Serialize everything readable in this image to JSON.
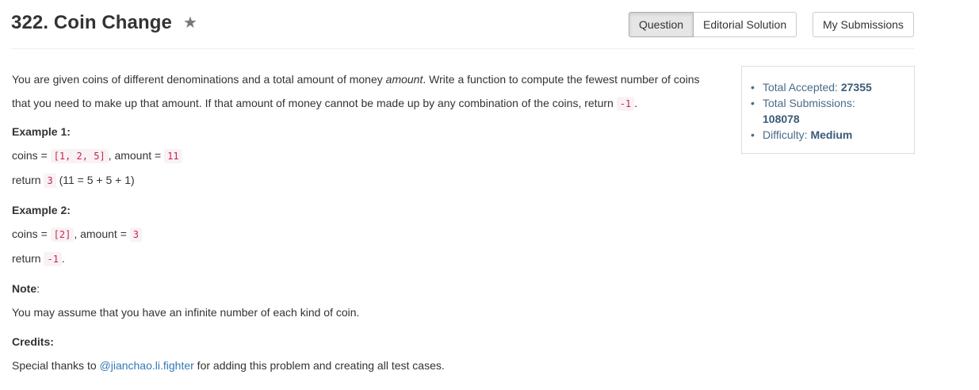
{
  "header": {
    "title": "322. Coin Change",
    "star_icon": "star-icon",
    "tabs": [
      {
        "label": "Question",
        "active": true
      },
      {
        "label": "Editorial Solution",
        "active": false
      }
    ],
    "my_submissions_label": "My Submissions"
  },
  "problem": {
    "intro_pre": "You are given coins of different denominations and a total amount of money ",
    "intro_em": "amount",
    "intro_post": ". Write a function to compute the fewest number of coins",
    "intro_line2": "that you need to make up that amount. If that amount of money cannot be made up by any combination of the coins, return ",
    "intro_code": "-1",
    "intro_end": ".",
    "example1": {
      "heading": "Example 1:",
      "coins_label": "coins = ",
      "coins_code": "[1, 2, 5]",
      "amount_label": ", amount = ",
      "amount_code": "11",
      "return_label": "return ",
      "return_code": "3",
      "return_note": " (11 = 5 + 5 + 1)"
    },
    "example2": {
      "heading": "Example 2:",
      "coins_label": "coins = ",
      "coins_code": "[2]",
      "amount_label": ", amount = ",
      "amount_code": "3",
      "return_label": "return ",
      "return_code": "-1",
      "return_note": "."
    },
    "note": {
      "heading": "Note",
      "colon": ":",
      "text": "You may assume that you have an infinite number of each kind of coin."
    },
    "credits": {
      "heading": "Credits:",
      "pre": "Special thanks to ",
      "link": "@jianchao.li.fighter",
      "post": " for adding this problem and creating all test cases."
    }
  },
  "stats": {
    "accepted_label": "Total Accepted: ",
    "accepted_value": "27355",
    "submissions_label": "Total Submissions: ",
    "submissions_value": "108078",
    "difficulty_label": "Difficulty: ",
    "difficulty_value": "Medium"
  }
}
